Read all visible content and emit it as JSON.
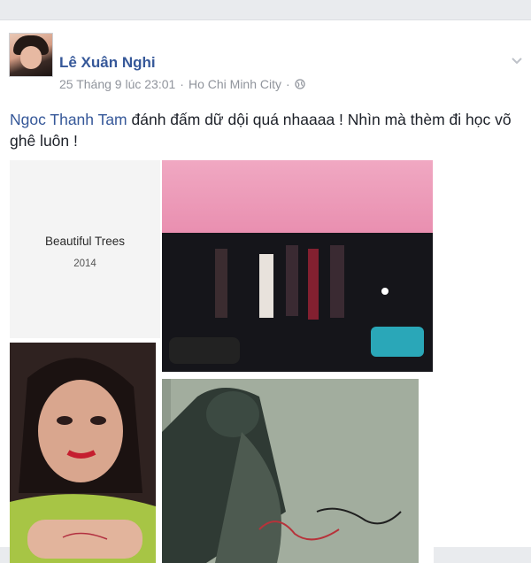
{
  "post": {
    "author": "Lê Xuân Nghi",
    "timestamp": "25 Tháng 9 lúc 23:01",
    "separator": "·",
    "location": "Ho Chi Minh City",
    "separator2": "·",
    "privacy_icon": "globe-icon",
    "tagged_name": "Ngoc Thanh Tam",
    "message": " đánh đấm dữ dội quá nhaaaa ! Nhìn mà thèm đi học võ ghê luôn !"
  },
  "gallery": {
    "poster_title": "Beautiful Trees",
    "poster_year": "2014"
  },
  "colors": {
    "link": "#365899",
    "meta": "#90949c",
    "text": "#1d2129",
    "background": "#e9ebee"
  }
}
